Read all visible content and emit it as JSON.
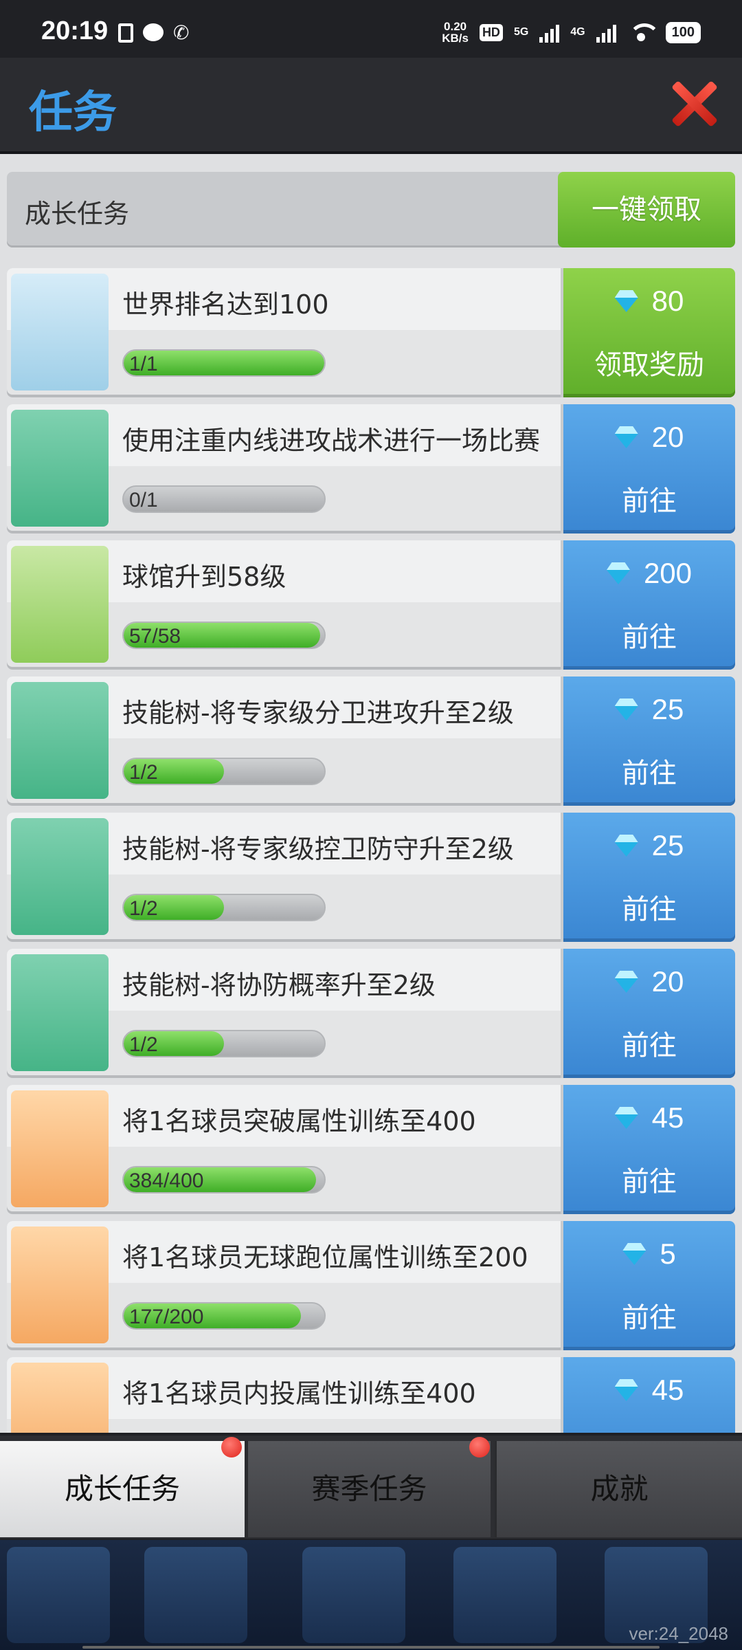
{
  "status_bar": {
    "time": "20:19",
    "net_speed_value": "0.20",
    "net_speed_unit": "KB/s",
    "hd_label": "HD",
    "sim1_label": "5G",
    "sim2_label": "4G",
    "battery": "100"
  },
  "header": {
    "title": "任务"
  },
  "section": {
    "label": "成长任务",
    "claim_all_label": "一键领取"
  },
  "tasks": [
    {
      "title": "世界排名达到100",
      "progress_text": "1/1",
      "progress": 1.0,
      "reward": "80",
      "action": "领取奖励",
      "style": "green",
      "icon": "trophy-podium-icon"
    },
    {
      "title": "使用注重内线进攻战术进行一场比赛",
      "progress_text": "0/1",
      "progress": 0.0,
      "reward": "20",
      "action": "前往",
      "style": "blue",
      "icon": "tactics-board-icon"
    },
    {
      "title": "球馆升到58级",
      "progress_text": "57/58",
      "progress": 0.98,
      "reward": "200",
      "action": "前往",
      "style": "blue",
      "icon": "rising-graph-icon"
    },
    {
      "title": "技能树-将专家级分卫进攻升至2级",
      "progress_text": "1/2",
      "progress": 0.5,
      "reward": "25",
      "action": "前往",
      "style": "blue",
      "icon": "tactics-board-icon"
    },
    {
      "title": "技能树-将专家级控卫防守升至2级",
      "progress_text": "1/2",
      "progress": 0.5,
      "reward": "25",
      "action": "前往",
      "style": "blue",
      "icon": "tactics-board-icon"
    },
    {
      "title": "技能树-将协防概率升至2级",
      "progress_text": "1/2",
      "progress": 0.5,
      "reward": "20",
      "action": "前往",
      "style": "blue",
      "icon": "tactics-board-icon"
    },
    {
      "title": "将1名球员突破属性训练至400",
      "progress_text": "384/400",
      "progress": 0.96,
      "reward": "45",
      "action": "前往",
      "style": "blue",
      "icon": "jersey-basketball-icon"
    },
    {
      "title": "将1名球员无球跑位属性训练至200",
      "progress_text": "177/200",
      "progress": 0.885,
      "reward": "5",
      "action": "前往",
      "style": "blue",
      "icon": "jersey-basketball-icon"
    },
    {
      "title": "将1名球员内投属性训练至400",
      "progress_text": "",
      "progress": 0.0,
      "reward": "45",
      "action": "",
      "style": "blue",
      "icon": "jersey-basketball-icon"
    }
  ],
  "tabs": [
    {
      "label": "成长任务",
      "active": true,
      "badge": true
    },
    {
      "label": "赛季任务",
      "active": false,
      "badge": true
    },
    {
      "label": "成就",
      "active": false,
      "badge": false
    }
  ],
  "footer": {
    "version": "ver:24_2048"
  },
  "colors": {
    "accent_blue": "#3c9be8",
    "claim_green": "#6bbd30",
    "go_blue": "#4a98df",
    "close_red": "#e0352b"
  }
}
